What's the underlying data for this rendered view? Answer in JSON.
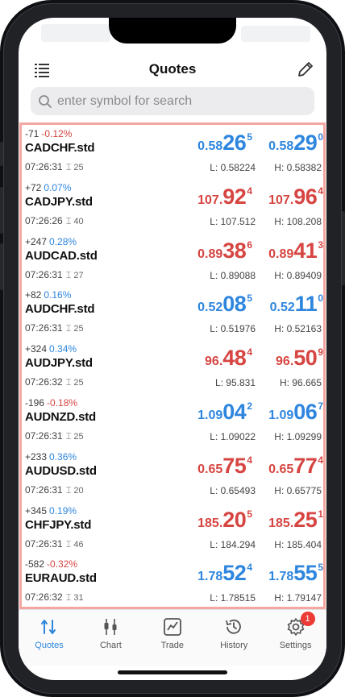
{
  "header": {
    "title": "Quotes"
  },
  "search": {
    "placeholder": "enter symbol for search"
  },
  "quotes": [
    {
      "change_points": "-71",
      "change_pct": "-0.12%",
      "symbol": "CADCHF.std",
      "time": "07:26:31",
      "spread": "25",
      "bid": {
        "pre": "0.58",
        "big": "26",
        "sup": "5"
      },
      "ask": {
        "pre": "0.58",
        "big": "29",
        "sup": "0"
      },
      "low": "L: 0.58224",
      "high": "H: 0.58382",
      "change_color": "red",
      "price_color": "blue"
    },
    {
      "change_points": "+72",
      "change_pct": "0.07%",
      "symbol": "CADJPY.std",
      "time": "07:26:26",
      "spread": "40",
      "bid": {
        "pre": "107.",
        "big": "92",
        "sup": "4"
      },
      "ask": {
        "pre": "107.",
        "big": "96",
        "sup": "4"
      },
      "low": "L: 107.512",
      "high": "H: 108.208",
      "change_color": "blue",
      "price_color": "red"
    },
    {
      "change_points": "+247",
      "change_pct": "0.28%",
      "symbol": "AUDCAD.std",
      "time": "07:26:31",
      "spread": "27",
      "bid": {
        "pre": "0.89",
        "big": "38",
        "sup": "6"
      },
      "ask": {
        "pre": "0.89",
        "big": "41",
        "sup": "3"
      },
      "low": "L: 0.89088",
      "high": "H: 0.89409",
      "change_color": "blue",
      "price_color": "red"
    },
    {
      "change_points": "+82",
      "change_pct": "0.16%",
      "symbol": "AUDCHF.std",
      "time": "07:26:31",
      "spread": "25",
      "bid": {
        "pre": "0.52",
        "big": "08",
        "sup": "5"
      },
      "ask": {
        "pre": "0.52",
        "big": "11",
        "sup": "0"
      },
      "low": "L: 0.51976",
      "high": "H: 0.52163",
      "change_color": "blue",
      "price_color": "blue"
    },
    {
      "change_points": "+324",
      "change_pct": "0.34%",
      "symbol": "AUDJPY.std",
      "time": "07:26:32",
      "spread": "25",
      "bid": {
        "pre": "96.",
        "big": "48",
        "sup": "4"
      },
      "ask": {
        "pre": "96.",
        "big": "50",
        "sup": "9"
      },
      "low": "L: 95.831",
      "high": "H: 96.665",
      "change_color": "blue",
      "price_color": "red"
    },
    {
      "change_points": "-196",
      "change_pct": "-0.18%",
      "symbol": "AUDNZD.std",
      "time": "07:26:31",
      "spread": "25",
      "bid": {
        "pre": "1.09",
        "big": "04",
        "sup": "2"
      },
      "ask": {
        "pre": "1.09",
        "big": "06",
        "sup": "7"
      },
      "low": "L: 1.09022",
      "high": "H: 1.09299",
      "change_color": "red",
      "price_color": "blue"
    },
    {
      "change_points": "+233",
      "change_pct": "0.36%",
      "symbol": "AUDUSD.std",
      "time": "07:26:31",
      "spread": "20",
      "bid": {
        "pre": "0.65",
        "big": "75",
        "sup": "4"
      },
      "ask": {
        "pre": "0.65",
        "big": "77",
        "sup": "4"
      },
      "low": "L: 0.65493",
      "high": "H: 0.65775",
      "change_color": "blue",
      "price_color": "red"
    },
    {
      "change_points": "+345",
      "change_pct": "0.19%",
      "symbol": "CHFJPY.std",
      "time": "07:26:31",
      "spread": "46",
      "bid": {
        "pre": "185.",
        "big": "20",
        "sup": "5"
      },
      "ask": {
        "pre": "185.",
        "big": "25",
        "sup": "1"
      },
      "low": "L: 184.294",
      "high": "H: 185.404",
      "change_color": "blue",
      "price_color": "red"
    },
    {
      "change_points": "-582",
      "change_pct": "-0.32%",
      "symbol": "EURAUD.std",
      "time": "07:26:32",
      "spread": "31",
      "bid": {
        "pre": "1.78",
        "big": "52",
        "sup": "4"
      },
      "ask": {
        "pre": "1.78",
        "big": "55",
        "sup": "5"
      },
      "low": "L: 1.78515",
      "high": "H: 1.79147",
      "change_color": "red",
      "price_color": "blue"
    }
  ],
  "tabs": [
    {
      "label": "Quotes",
      "icon": "quotes-icon",
      "active": true
    },
    {
      "label": "Chart",
      "icon": "chart-icon",
      "active": false
    },
    {
      "label": "Trade",
      "icon": "trade-icon",
      "active": false
    },
    {
      "label": "History",
      "icon": "history-icon",
      "active": false
    },
    {
      "label": "Settings",
      "icon": "settings-icon",
      "active": false,
      "badge": "1"
    }
  ],
  "colors": {
    "blue": "#2e86de",
    "red": "#d64541",
    "highlight_border": "#f4a6a0"
  }
}
